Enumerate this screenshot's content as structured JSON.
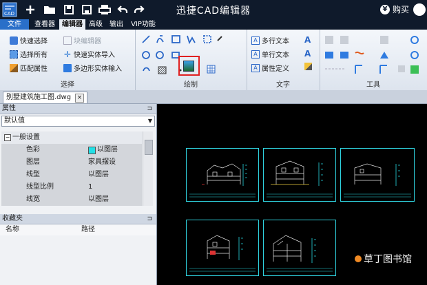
{
  "app": {
    "title": "迅捷CAD编辑器",
    "buy_label": "购买",
    "logo_text": "CAD"
  },
  "menu": {
    "file": "文件",
    "items": [
      "查看器",
      "编辑器",
      "高级",
      "输出",
      "VIP功能"
    ],
    "active": "编辑器"
  },
  "ribbon": {
    "select": {
      "name": "选择",
      "quick_select": "快速选择",
      "select_all": "选择所有",
      "match_props": "匹配属性",
      "block_editor": "块编辑器",
      "quick_entity_import": "快速实体导入",
      "polygon_entity_input": "多边形实体输入"
    },
    "draw": {
      "name": "绘制"
    },
    "text": {
      "name": "文字",
      "mtext": "多行文本",
      "stext": "单行文本",
      "attdef": "属性定义"
    },
    "tools": {
      "name": "工具"
    }
  },
  "document": {
    "tab_label": "别墅建筑施工图.dwg"
  },
  "properties": {
    "title": "属性",
    "pin": "ᵖ",
    "combo_value": "默认值",
    "section": "一般设置",
    "rows": [
      {
        "key": "色彩",
        "value": "以图层",
        "swatch": "#22e0e6"
      },
      {
        "key": "图层",
        "value": "家具摆设"
      },
      {
        "key": "线型",
        "value": "以图层"
      },
      {
        "key": "线型比例",
        "value": "1"
      },
      {
        "key": "线宽",
        "value": "以图层"
      }
    ]
  },
  "favorites": {
    "title": "收藏夹",
    "col_name": "名称",
    "col_path": "路径"
  },
  "watermark": {
    "text": "草丁图书馆"
  },
  "colors": {
    "accent": "#2a6fc9",
    "title_bg": "#0f1a2b",
    "sheet_border": "#2fd3e0",
    "highlight": "#e02020"
  }
}
